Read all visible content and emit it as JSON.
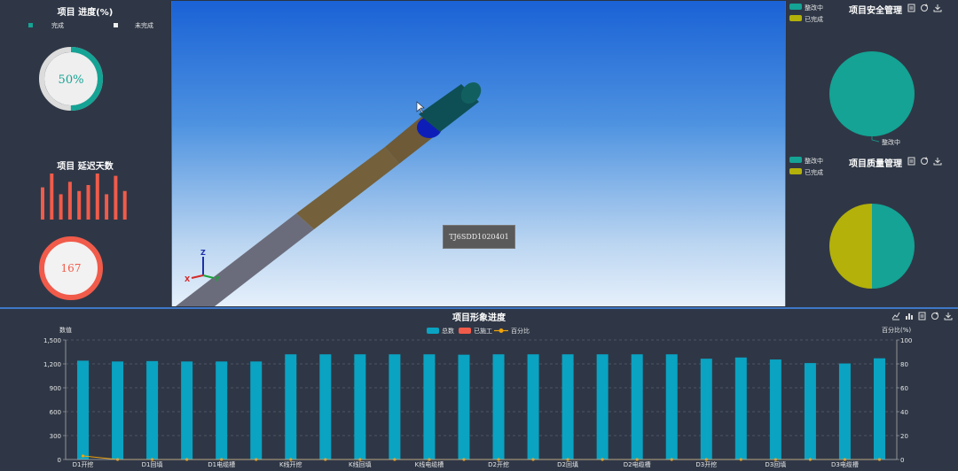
{
  "progress_panel": {
    "title": "项目 进度(%)",
    "legend": [
      {
        "label": "完成",
        "color": "#14a394"
      },
      {
        "label": "未完成",
        "color": "#f0f0f0"
      }
    ],
    "percent_label": "50%",
    "percent": 50
  },
  "delay_panel": {
    "title": "项目 延迟天数",
    "days_label": "167",
    "bars": [
      0.7,
      1.0,
      0.55,
      0.82,
      0.62,
      0.75,
      1.0,
      0.55,
      0.95,
      0.62
    ]
  },
  "viewport": {
    "selected_label": "TJ6SDD1020401",
    "axis": {
      "x": "X",
      "y": "Y",
      "z": "Z"
    }
  },
  "safety_panel": {
    "title": "项目安全管理",
    "legend": [
      {
        "label": "整改中",
        "color": "#14a394"
      },
      {
        "label": "已完成",
        "color": "#b3b10a"
      }
    ],
    "slice_label": "整改中",
    "values": [
      {
        "name": "整改中",
        "value": 1
      },
      {
        "name": "已完成",
        "value": 0
      }
    ]
  },
  "quality_panel": {
    "title": "项目质量管理",
    "legend": [
      {
        "label": "整改中",
        "color": "#14a394"
      },
      {
        "label": "已完成",
        "color": "#b3b10a"
      }
    ],
    "values": [
      {
        "name": "整改中",
        "value": 1
      },
      {
        "name": "已完成",
        "value": 1
      }
    ]
  },
  "bottom_chart": {
    "title": "项目形象进度",
    "left_axis_title": "数值",
    "right_axis_title": "百分比(%)"
  },
  "chart_data": {
    "type": "bar",
    "categories": [
      "D1开挖",
      "D1开挖",
      "D1回填",
      "D1回填",
      "D1电缆槽",
      "D1电缆槽",
      "K线开挖",
      "K线开挖",
      "K线回填",
      "K线回填",
      "K线电缆槽",
      "K线电缆槽",
      "D2开挖",
      "D2开挖",
      "D2回填",
      "D2回填",
      "D2电缆槽",
      "D2电缆槽",
      "D3开挖",
      "D3开挖",
      "D3回填",
      "D3回填",
      "D3电缆槽",
      "D3电缆槽"
    ],
    "x_tick_labels": [
      "D1开挖",
      "D1回填",
      "D1电缆槽",
      "K线开挖",
      "K线回填",
      "K线电缆槽",
      "D2开挖",
      "D2回填",
      "D2电缆槽",
      "D3开挖",
      "D3回填",
      "D3电缆槽"
    ],
    "series": [
      {
        "name": "总数",
        "color": "#0aa3c2",
        "axis": "left",
        "values": [
          1240,
          1230,
          1235,
          1230,
          1230,
          1230,
          1320,
          1320,
          1320,
          1320,
          1320,
          1315,
          1320,
          1320,
          1320,
          1320,
          1320,
          1320,
          1265,
          1280,
          1255,
          1210,
          1205,
          1270
        ]
      },
      {
        "name": "已施工",
        "color": "#f15b4a",
        "axis": "left",
        "values": [
          0,
          0,
          0,
          0,
          0,
          0,
          0,
          0,
          0,
          0,
          0,
          0,
          0,
          0,
          0,
          0,
          0,
          0,
          0,
          0,
          0,
          0,
          0,
          0
        ]
      },
      {
        "name": "百分比",
        "color": "#f0a30a",
        "axis": "right",
        "values": [
          3,
          0,
          0,
          0,
          0,
          0,
          0,
          0,
          0,
          0,
          0,
          0,
          0,
          0,
          0,
          0,
          0,
          0,
          0,
          0,
          0,
          0,
          0,
          0
        ]
      }
    ],
    "ylim": [
      0,
      1500
    ],
    "yticks": [
      0,
      300,
      600,
      900,
      1200,
      1500
    ],
    "ytick_labels": [
      "0",
      "300",
      "600",
      "900",
      "1,200",
      "1,500"
    ],
    "y2lim": [
      0,
      100
    ],
    "y2ticks": [
      0,
      20,
      40,
      60,
      80,
      100
    ],
    "grid": true,
    "legend_position": "top-center"
  }
}
